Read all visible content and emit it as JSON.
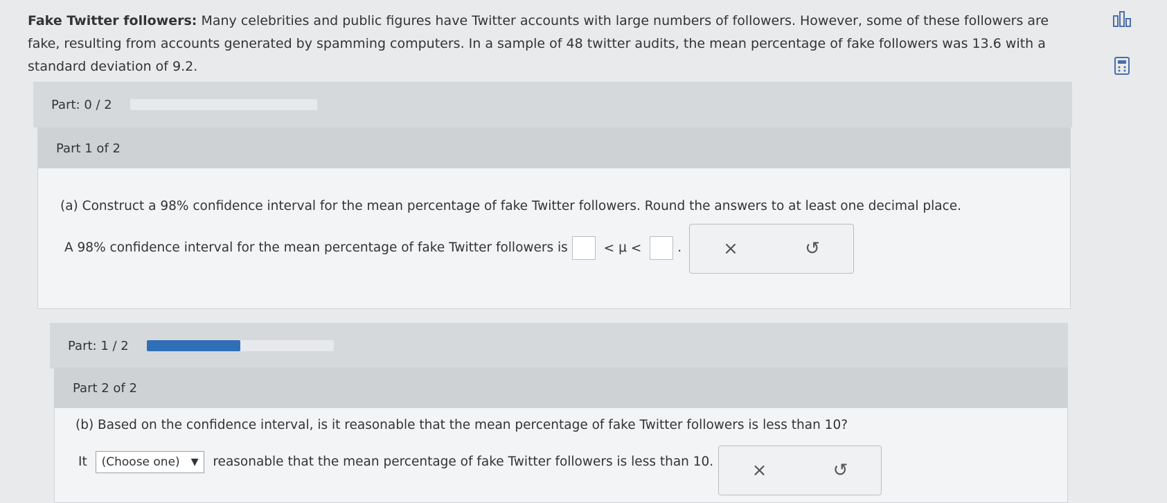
{
  "problem": {
    "title": "Fake Twitter followers:",
    "text": "Many celebrities and public figures have Twitter accounts with large numbers of followers. However, some of these followers are fake, resulting from accounts generated by spamming computers. In a sample of 48 twitter audits, the mean percentage of fake followers was 13.6 with a standard deviation of 9.2."
  },
  "rail": {
    "stats_icon": "bar-chart-icon",
    "calc_icon": "calculator-icon"
  },
  "part1": {
    "progress_label": "Part: 0 / 2",
    "progress_fraction": 0,
    "header": "Part 1 of 2",
    "question": "(a) Construct a 98% confidence interval for the mean percentage of fake Twitter followers. Round the answers to at least one decimal place.",
    "prompt": "A 98% confidence interval for the mean percentage of fake Twitter followers is",
    "lt1": "<",
    "mu": "μ",
    "lt2": "<",
    "end": ".",
    "clear": "×",
    "undo": "↺"
  },
  "part2": {
    "progress_label": "Part: 1 / 2",
    "progress_fraction": 0.5,
    "header": "Part 2 of 2",
    "question": "(b) Based on the confidence interval, is it reasonable that the mean percentage of fake Twitter followers is less than 10?",
    "prefix": "It",
    "select_value": "(Choose one)",
    "suffix": "reasonable that the mean percentage of fake Twitter followers is less than 10.",
    "clear": "×",
    "undo": "↺"
  }
}
